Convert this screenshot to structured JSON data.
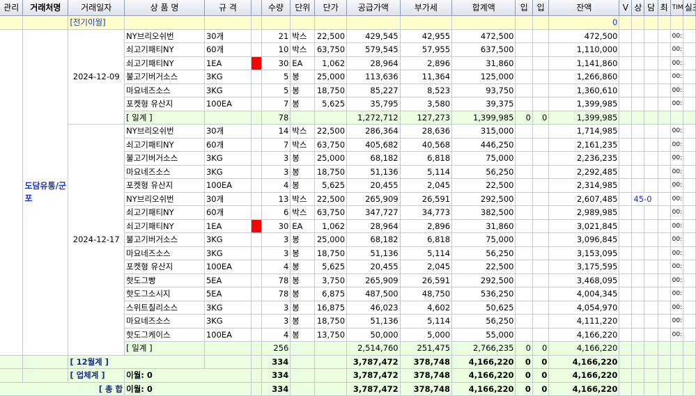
{
  "columns": [
    "관리",
    "거래처명",
    "거래일자",
    "상 품 명",
    "규 격",
    "",
    "수량",
    "단위",
    "단가",
    "공급가액",
    "부가세",
    "합계액",
    "입",
    "입",
    "잔액",
    "V",
    "상",
    "담",
    "최",
    "TIM",
    "실조"
  ],
  "prev_balance": {
    "label": "[전기이월]",
    "balance": "0"
  },
  "customer": {
    "name": "도담유통/군포",
    "extra": "45-0"
  },
  "groups": [
    {
      "date": "2024-12-09",
      "rows": [
        {
          "item": "NY브리오쉬번",
          "spec": "30개",
          "flag": false,
          "qty": "21",
          "unit": "박스",
          "price": "22,500",
          "supply": "429,545",
          "vat": "42,955",
          "total": "472,500",
          "balance": "472,500",
          "misc": "00:"
        },
        {
          "item": "쇠고기패티NY",
          "spec": "60개",
          "flag": false,
          "qty": "10",
          "unit": "박스",
          "price": "63,750",
          "supply": "579,545",
          "vat": "57,955",
          "total": "637,500",
          "balance": "1,110,000",
          "misc": "00:"
        },
        {
          "item": "쇠고기패티NY",
          "spec": "1EA",
          "flag": true,
          "qty": "30",
          "unit": "EA",
          "price": "1,062",
          "supply": "28,964",
          "vat": "2,896",
          "total": "31,860",
          "balance": "1,141,860",
          "misc": "00:"
        },
        {
          "item": "불고기버거소스",
          "spec": "3KG",
          "flag": false,
          "qty": "5",
          "unit": "봉",
          "price": "25,000",
          "supply": "113,636",
          "vat": "11,364",
          "total": "125,000",
          "balance": "1,266,860",
          "misc": "00:"
        },
        {
          "item": "마요네즈소스",
          "spec": "3KG",
          "flag": false,
          "qty": "5",
          "unit": "봉",
          "price": "18,750",
          "supply": "85,227",
          "vat": "8,523",
          "total": "93,750",
          "balance": "1,360,610",
          "misc": "00:"
        },
        {
          "item": "포켓형 유산지",
          "spec": "100EA",
          "flag": false,
          "qty": "7",
          "unit": "봉",
          "price": "5,625",
          "supply": "35,795",
          "vat": "3,580",
          "total": "39,375",
          "balance": "1,399,985",
          "misc": "00:"
        }
      ],
      "subtotal": {
        "label": "[ 일계 ]",
        "qty": "78",
        "supply": "1,272,712",
        "vat": "127,273",
        "total": "1,399,985",
        "in1": "0",
        "in2": "0",
        "balance": "1,399,985"
      }
    },
    {
      "date": "2024-12-17",
      "rows": [
        {
          "item": "NY브리오쉬번",
          "spec": "30개",
          "flag": false,
          "qty": "14",
          "unit": "박스",
          "price": "22,500",
          "supply": "286,364",
          "vat": "28,636",
          "total": "315,000",
          "balance": "1,714,985",
          "misc": "00:"
        },
        {
          "item": "쇠고기패티NY",
          "spec": "60개",
          "flag": false,
          "qty": "7",
          "unit": "박스",
          "price": "63,750",
          "supply": "405,682",
          "vat": "40,568",
          "total": "446,250",
          "balance": "2,161,235",
          "misc": "00:"
        },
        {
          "item": "불고기버거소스",
          "spec": "3KG",
          "flag": false,
          "qty": "3",
          "unit": "봉",
          "price": "25,000",
          "supply": "68,182",
          "vat": "6,818",
          "total": "75,000",
          "balance": "2,236,235",
          "misc": "00:"
        },
        {
          "item": "마요네즈소스",
          "spec": "3KG",
          "flag": false,
          "qty": "3",
          "unit": "봉",
          "price": "18,750",
          "supply": "51,136",
          "vat": "5,114",
          "total": "56,250",
          "balance": "2,292,485",
          "misc": "00:"
        },
        {
          "item": "포켓형 유산지",
          "spec": "100EA",
          "flag": false,
          "qty": "4",
          "unit": "봉",
          "price": "5,625",
          "supply": "20,455",
          "vat": "2,045",
          "total": "22,500",
          "balance": "2,314,985",
          "misc": "00:"
        },
        {
          "item": "NY브리오쉬번",
          "spec": "30개",
          "flag": false,
          "qty": "13",
          "unit": "박스",
          "price": "22,500",
          "supply": "265,909",
          "vat": "26,591",
          "total": "292,500",
          "balance": "2,607,485",
          "misc": "00:"
        },
        {
          "item": "쇠고기패티NY",
          "spec": "60개",
          "flag": false,
          "qty": "6",
          "unit": "박스",
          "price": "63,750",
          "supply": "347,727",
          "vat": "34,773",
          "total": "382,500",
          "balance": "2,989,985",
          "misc": "00:"
        },
        {
          "item": "쇠고기패티NY",
          "spec": "1EA",
          "flag": true,
          "qty": "30",
          "unit": "EA",
          "price": "1,062",
          "supply": "28,964",
          "vat": "2,896",
          "total": "31,860",
          "balance": "3,021,845",
          "misc": "00:"
        },
        {
          "item": "불고기버거소스",
          "spec": "3KG",
          "flag": false,
          "qty": "3",
          "unit": "봉",
          "price": "25,000",
          "supply": "68,182",
          "vat": "6,818",
          "total": "75,000",
          "balance": "3,096,845",
          "misc": "00:"
        },
        {
          "item": "마요네즈소스",
          "spec": "3KG",
          "flag": false,
          "qty": "3",
          "unit": "봉",
          "price": "18,750",
          "supply": "51,136",
          "vat": "5,114",
          "total": "56,250",
          "balance": "3,153,095",
          "misc": "00:"
        },
        {
          "item": "포켓형 유산지",
          "spec": "100EA",
          "flag": false,
          "qty": "4",
          "unit": "봉",
          "price": "5,625",
          "supply": "20,455",
          "vat": "2,045",
          "total": "22,500",
          "balance": "3,175,595",
          "misc": "00:"
        },
        {
          "item": "핫도그빵",
          "spec": "5EA",
          "flag": false,
          "qty": "78",
          "unit": "봉",
          "price": "3,750",
          "supply": "265,909",
          "vat": "26,591",
          "total": "292,500",
          "balance": "3,468,095",
          "misc": "00:"
        },
        {
          "item": "핫도그소시지",
          "spec": "5EA",
          "flag": false,
          "qty": "78",
          "unit": "봉",
          "price": "6,875",
          "supply": "487,500",
          "vat": "48,750",
          "total": "536,250",
          "balance": "4,004,345",
          "misc": "00:"
        },
        {
          "item": "스위트칠리소스",
          "spec": "3KG",
          "flag": false,
          "qty": "3",
          "unit": "봉",
          "price": "16,875",
          "supply": "46,023",
          "vat": "4,602",
          "total": "50,625",
          "balance": "4,054,970",
          "misc": "00:"
        },
        {
          "item": "마요네즈소스",
          "spec": "3KG",
          "flag": false,
          "qty": "3",
          "unit": "봉",
          "price": "18,750",
          "supply": "51,136",
          "vat": "5,114",
          "total": "56,250",
          "balance": "4,111,220",
          "misc": "00:"
        },
        {
          "item": "핫도그케이스",
          "spec": "100EA",
          "flag": false,
          "qty": "4",
          "unit": "봉",
          "price": "13,750",
          "supply": "50,000",
          "vat": "5,000",
          "total": "55,000",
          "balance": "4,166,220",
          "misc": "00:"
        }
      ],
      "subtotal": {
        "label": "[ 일계 ]",
        "qty": "256",
        "supply": "2,514,760",
        "vat": "251,475",
        "total": "2,766,235",
        "in1": "0",
        "in2": "0",
        "balance": "4,166,220"
      }
    }
  ],
  "month_total": {
    "label": "[ 12월계 ]",
    "qty": "334",
    "supply": "3,787,472",
    "vat": "378,748",
    "total": "4,166,220",
    "in1": "0",
    "in2": "0",
    "balance": "4,166,220"
  },
  "vendor_total": {
    "label": "[ 업체계 ]",
    "carry": "이월: 0",
    "qty": "334",
    "supply": "3,787,472",
    "vat": "378,748",
    "total": "4,166,220",
    "in1": "0",
    "in2": "0",
    "balance": "4,166,220"
  },
  "grand_total": {
    "label": "[ 총 합",
    "carry": "이월: 0",
    "qty": "334",
    "supply": "3,787,472",
    "vat": "378,748",
    "total": "4,166,220",
    "in1": "0",
    "in2": "0",
    "balance": "4,166,220"
  }
}
